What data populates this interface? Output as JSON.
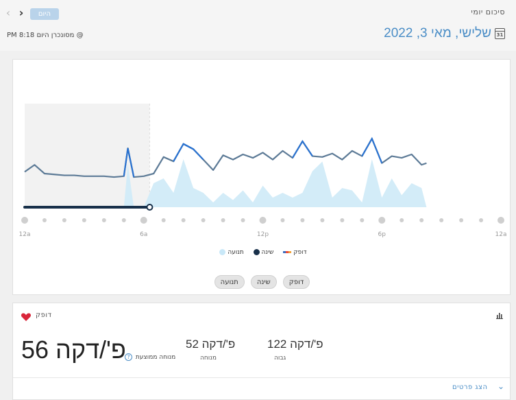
{
  "header": {
    "title": "סיכום יומי",
    "today_button": "היום",
    "sync_text": "PM 8:18 מסונכרן היום @",
    "date": "שלישי, מאי 3, 2022",
    "calendar_day": "31"
  },
  "chart": {
    "x_labels": [
      "12a",
      "6a",
      "12p",
      "6p",
      "12a"
    ],
    "legend": {
      "heart_rate": "דופק",
      "sleep": "שינה",
      "movement": "תנועה"
    },
    "toggles": [
      "תנועה",
      "שינה",
      "דופק"
    ],
    "colors": {
      "heart_line": "#5c7a96",
      "heart_peak": "#2a72d0",
      "movement_fill": "#d3ecf8",
      "sleep_bar": "#18304a",
      "sleep_shade": "#f2f2f2"
    }
  },
  "chart_data": {
    "type": "line",
    "x_ticks": [
      "12a",
      "6a",
      "12p",
      "6p",
      "12a"
    ],
    "series": [
      {
        "name": "דופק",
        "x_hours": [
          0,
          0.5,
          1,
          1.5,
          2,
          2.5,
          3,
          3.5,
          4,
          4.5,
          5,
          5.2,
          5.5,
          6,
          6.5,
          7,
          7.5,
          8,
          8.5,
          9,
          9.5,
          10,
          10.5,
          11,
          11.5,
          12,
          12.5,
          13,
          13.5,
          14,
          14.5,
          15,
          15.5,
          16,
          16.5,
          17,
          17.5,
          18,
          18.5,
          19,
          19.5,
          20,
          20.25
        ],
        "values": [
          58,
          66,
          56,
          55,
          54,
          54,
          53,
          53,
          53,
          52,
          53,
          85,
          52,
          53,
          56,
          75,
          70,
          90,
          84,
          72,
          60,
          77,
          72,
          78,
          74,
          80,
          72,
          82,
          74,
          93,
          76,
          75,
          79,
          72,
          82,
          76,
          96,
          68,
          76,
          74,
          78,
          66,
          68
        ]
      },
      {
        "name": "תנועה",
        "x_hours": [
          0,
          5,
          5.2,
          5.5,
          6,
          6.5,
          7,
          7.5,
          8,
          8.5,
          9,
          9.5,
          10,
          10.5,
          11,
          11.5,
          12,
          12.5,
          13,
          13.5,
          14,
          14.5,
          15,
          15.5,
          16,
          16.5,
          17,
          17.5,
          18,
          18.5,
          19,
          19.5,
          20,
          20.25
        ],
        "values": [
          0,
          0,
          0.9,
          0,
          0,
          0.5,
          0.6,
          0.3,
          1.0,
          0.4,
          0.3,
          0.1,
          0.3,
          0.15,
          0.35,
          0.1,
          0.45,
          0.2,
          0.3,
          0.2,
          0.3,
          0.75,
          0.95,
          0.2,
          0.4,
          0.35,
          0.1,
          1.0,
          0.2,
          0.6,
          0.25,
          0.5,
          0.4,
          0
        ]
      }
    ],
    "sleep_range_hours": [
      0,
      6.3
    ]
  },
  "heart_rate": {
    "label": "דופק",
    "resting_avg_value": "56 פ'/דקה",
    "resting_avg_label": "מנוחה ממוצעת",
    "help": "?",
    "rest_value": "52 פ'/דקה",
    "rest_label": "מנוחה",
    "high_value": "122 פ'/דקה",
    "high_label": "גבוה",
    "details_link": "הצג פרטים"
  }
}
